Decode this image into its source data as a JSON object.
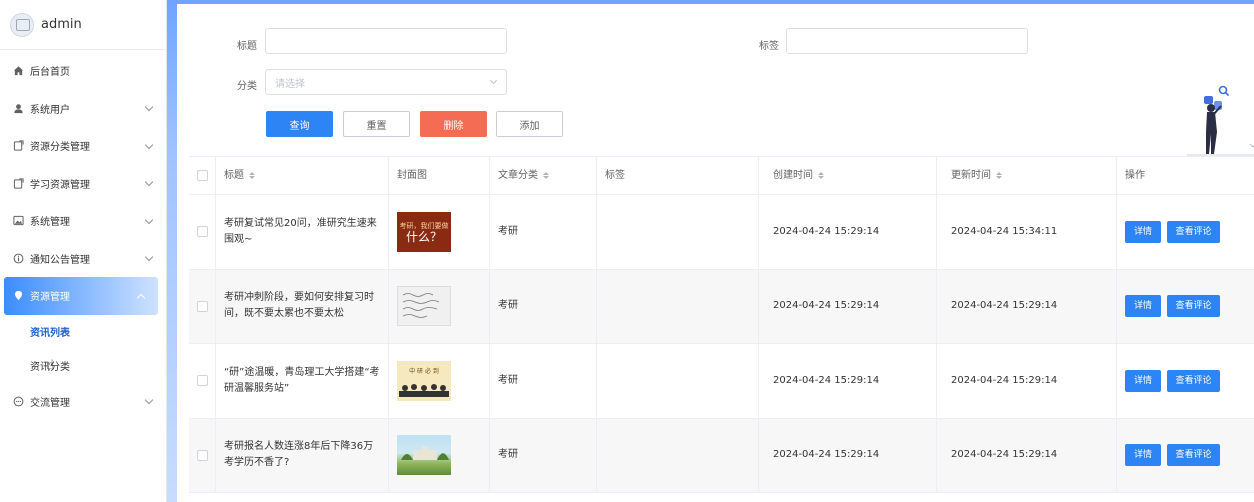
{
  "brand": {
    "name": "admin"
  },
  "menu": {
    "items": [
      {
        "label": "后台首页",
        "icon": "home-icon"
      },
      {
        "label": "系统用户",
        "icon": "user-icon"
      },
      {
        "label": "资源分类管理",
        "icon": "tag-icon"
      },
      {
        "label": "学习资源管理",
        "icon": "tag-icon"
      },
      {
        "label": "系统管理",
        "icon": "image-icon"
      },
      {
        "label": "通知公告管理",
        "icon": "info-icon"
      },
      {
        "label": "资源管理",
        "icon": "location-pin-icon"
      },
      {
        "label": "交流管理",
        "icon": "chat-icon"
      }
    ],
    "sub": [
      "资讯列表",
      "资讯分类"
    ]
  },
  "form": {
    "title_label": "标题",
    "tag_label": "标签",
    "category_label": "分类",
    "category_placeholder": "请选择",
    "buttons": {
      "query": "查询",
      "reset": "重置",
      "delete": "删除",
      "add": "添加"
    }
  },
  "table": {
    "headers": [
      "标题",
      "封面图",
      "文章分类",
      "标签",
      "创建时间",
      "更新时间",
      "操作"
    ],
    "rows": [
      {
        "title": "考研复试常见20问，准研究生速来围观~",
        "cover_text": [
          "考研，我们要做",
          "什么？"
        ],
        "category": "考研",
        "tag": "",
        "created": "2024-04-24 15:29:14",
        "updated": "2024-04-24 15:34:11"
      },
      {
        "title": "考研冲刺阶段，要如何安排复习时间，既不要太累也不要太松",
        "cover_text": [],
        "category": "考研",
        "tag": "",
        "created": "2024-04-24 15:29:14",
        "updated": "2024-04-24 15:29:14"
      },
      {
        "title": "“研”途温暖，青岛理工大学搭建“考研温馨服务站”",
        "cover_text": [
          "中 研 必 到"
        ],
        "category": "考研",
        "tag": "",
        "created": "2024-04-24 15:29:14",
        "updated": "2024-04-24 15:29:14"
      },
      {
        "title": "考研报名人数连涨8年后下降36万 考学历不香了?",
        "cover_text": [],
        "category": "考研",
        "tag": "",
        "created": "2024-04-24 15:29:14",
        "updated": "2024-04-24 15:29:14"
      }
    ],
    "op_detail": "详情",
    "op_comment": "查看评论"
  },
  "colors": {
    "primary": "#2d84f5",
    "danger": "#f56c55",
    "menu_active": "#3b8cff"
  }
}
